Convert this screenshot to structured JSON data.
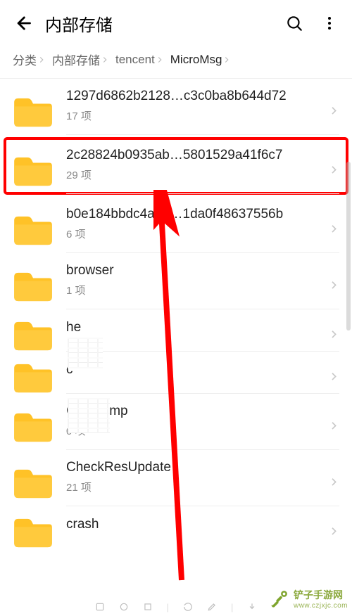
{
  "header": {
    "title": "内部存储"
  },
  "breadcrumb": {
    "items": [
      "分类",
      "内部存储",
      "tencent",
      "MicroMsg"
    ]
  },
  "list": {
    "item_suffix": " 项",
    "items": [
      {
        "name": "1297d6862b2128…c3c0ba8b644d72",
        "count": 17,
        "highlighted": false
      },
      {
        "name": "2c28824b0935ab…5801529a41f6c7",
        "count": 29,
        "highlighted": true
      },
      {
        "name": "b0e184bbdc4a1ff…1da0f48637556b",
        "count": 6,
        "highlighted": false
      },
      {
        "name": "browser",
        "count": 1,
        "highlighted": false
      },
      {
        "name": "he",
        "count": null,
        "highlighted": false,
        "obscured": true
      },
      {
        "name": "c",
        "count": null,
        "highlighted": false,
        "obscured": true
      },
      {
        "name": "CDNTemp",
        "count": 0,
        "highlighted": false
      },
      {
        "name": "CheckResUpdate",
        "count": 21,
        "highlighted": false
      },
      {
        "name": "crash",
        "count": null,
        "highlighted": false
      }
    ]
  },
  "watermark": {
    "line1": "铲子手游网",
    "line2": "www.czjxjc.com"
  }
}
